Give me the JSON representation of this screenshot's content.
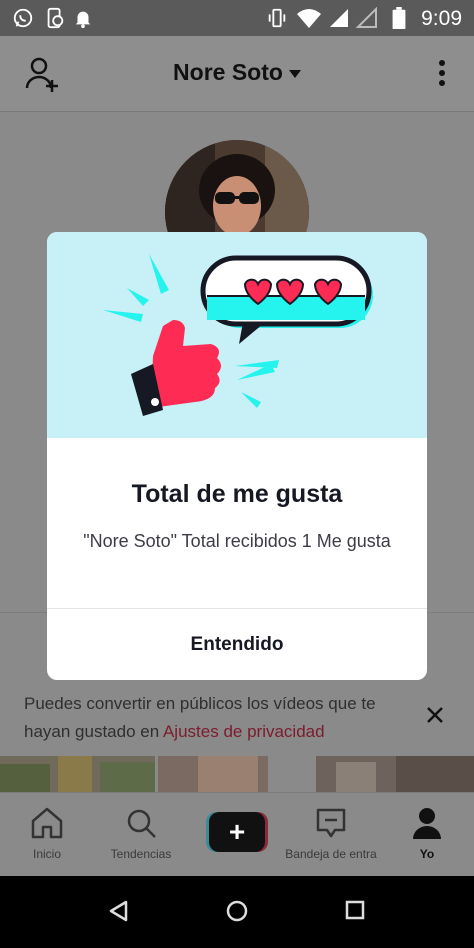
{
  "status_bar": {
    "time": "9:09",
    "left_icons": [
      "whatsapp-icon",
      "phone-sync-icon",
      "notification-bell-icon"
    ],
    "right_icons": [
      "vibrate-icon",
      "wifi-icon",
      "signal-icon",
      "no-signal-icon",
      "battery-icon"
    ]
  },
  "header": {
    "title": "Nore Soto",
    "left_icon": "add-user-icon",
    "right_icon": "more-vertical-icon"
  },
  "notice": {
    "text_before": "Puedes convertir en públicos los vídeos que te hayan gustado en ",
    "link": "Ajustes de privacidad",
    "close_icon": "close-icon"
  },
  "tabbar": {
    "tabs": [
      {
        "label": "Inicio",
        "icon": "home-icon"
      },
      {
        "label": "Tendencias",
        "icon": "search-icon"
      },
      {
        "label": "",
        "icon": "plus-icon"
      },
      {
        "label": "Bandeja de entra",
        "icon": "inbox-icon"
      },
      {
        "label": "Yo",
        "icon": "profile-icon"
      }
    ]
  },
  "navbar": {
    "icons": [
      "back-icon",
      "home-circle-icon",
      "recents-icon"
    ]
  },
  "modal": {
    "title": "Total de me gusta",
    "body": "\"Nore Soto\" Total recibidos 1 Me gusta",
    "button": "Entendido"
  },
  "colors": {
    "hero_bg": "#c8f0f7",
    "thumb_red": "#fe2c55",
    "cyan": "#25f4ee",
    "link": "#7a1d2c"
  }
}
